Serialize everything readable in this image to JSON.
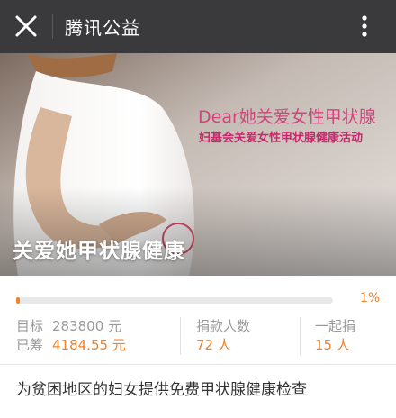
{
  "topbar": {
    "title": "腾讯公益",
    "close_icon": "close-icon",
    "more_icon": "more-vertical-icon",
    "background": "#3a3a3c"
  },
  "banner": {
    "line1": "Dear她关爱女性甲状腺",
    "line2": "妇基会关爱女性甲状腺健康活动",
    "headline": "关爱她甲状腺健康"
  },
  "progress": {
    "value": 0.01,
    "percent_label": "1%",
    "accent": "#f0822d"
  },
  "stats": {
    "goal_label": "目标",
    "goal_value": "283800 元",
    "raised_label": "已筹",
    "raised_value": "4184.55 元",
    "donors_label": "捐款人数",
    "donors_value": "72 人",
    "together_label": "一起捐",
    "together_value": "15 人"
  },
  "description": "为贫困地区的妇女提供免费甲状腺健康检查"
}
